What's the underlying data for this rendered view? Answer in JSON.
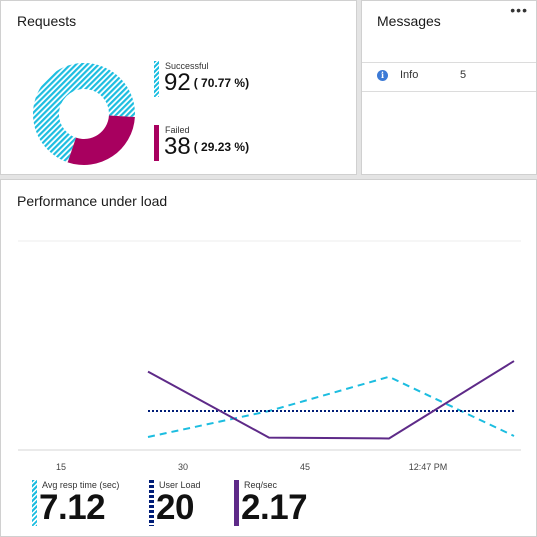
{
  "requests": {
    "title": "Requests",
    "successful": {
      "label": "Successful",
      "count": "92",
      "percent": "70.77",
      "color": "#1cbde0"
    },
    "failed": {
      "label": "Failed",
      "count": "38",
      "percent": "29.23",
      "color": "#a8005f"
    }
  },
  "messages": {
    "title": "Messages",
    "more_icon": "ellipsis-icon",
    "rows": [
      {
        "icon": "info-icon",
        "label": "Info",
        "count": "5"
      }
    ]
  },
  "performance": {
    "title": "Performance under load",
    "kpis": [
      {
        "label": "Avg resp time (sec)",
        "value": "7.12",
        "color": "#1cbde0"
      },
      {
        "label": "User Load",
        "value": "20",
        "color": "#001d78"
      },
      {
        "label": "Req/sec",
        "value": "2.17",
        "color": "#5e2a88"
      }
    ]
  },
  "chart_data": {
    "type": "line",
    "x_tick_labels": [
      "15",
      "30",
      "45",
      "12:47 PM"
    ],
    "series": [
      {
        "values_index": [
          0,
          1,
          2,
          3
        ],
        "values": [
          1.1,
          3.7,
          7.12,
          1.2
        ],
        "color": "#1cbde0",
        "style": "dashed"
      },
      {
        "values": [
          20,
          20,
          20,
          20
        ],
        "color": "#001d78",
        "style": "dotted"
      },
      {
        "values": [
          4.0,
          0.25,
          0.2,
          4.6
        ],
        "color": "#5e2a88",
        "style": "solid"
      }
    ],
    "grid": true,
    "legend": "bottom"
  }
}
